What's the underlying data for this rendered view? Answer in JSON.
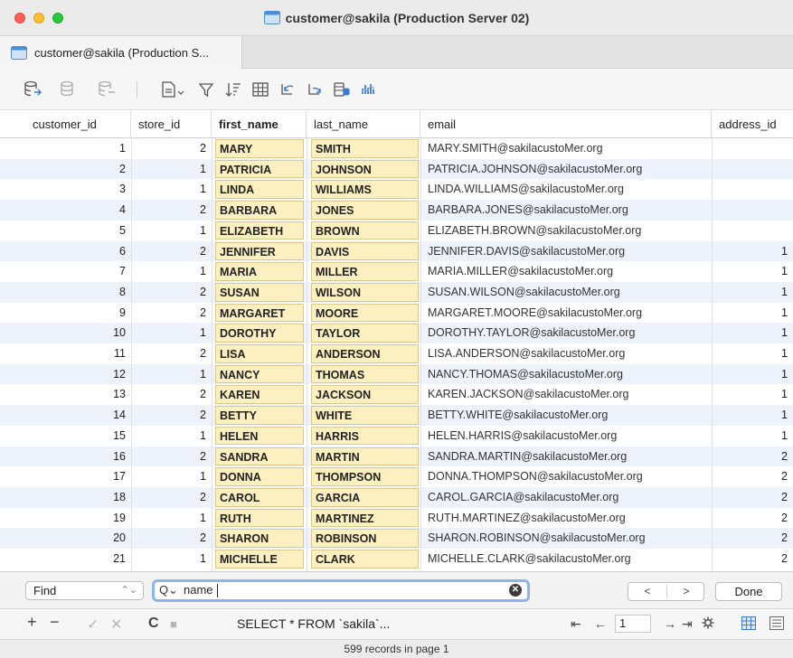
{
  "window": {
    "title": "customer@sakila (Production Server 02)"
  },
  "tabs": [
    {
      "label": "customer@sakila (Production S..."
    }
  ],
  "toolbar": {
    "icons": [
      "table-icon",
      "table-icon",
      "table-icon",
      "document-dropdown-icon",
      "filter-icon",
      "sort-icon",
      "grid-icon",
      "import-icon",
      "export-icon",
      "database-icon",
      "chart-icon"
    ]
  },
  "grid": {
    "columns": [
      "customer_id",
      "store_id",
      "first_name",
      "last_name",
      "email",
      "address_id"
    ],
    "rows": [
      {
        "id": "1",
        "store": "2",
        "first": "MARY",
        "last": "SMITH",
        "email": "MARY.SMITH@sakilacustoMer.org",
        "addr": ""
      },
      {
        "id": "2",
        "store": "1",
        "first": "PATRICIA",
        "last": "JOHNSON",
        "email": "PATRICIA.JOHNSON@sakilacustoMer.org",
        "addr": ""
      },
      {
        "id": "3",
        "store": "1",
        "first": "LINDA",
        "last": "WILLIAMS",
        "email": "LINDA.WILLIAMS@sakilacustoMer.org",
        "addr": ""
      },
      {
        "id": "4",
        "store": "2",
        "first": "BARBARA",
        "last": "JONES",
        "email": "BARBARA.JONES@sakilacustoMer.org",
        "addr": ""
      },
      {
        "id": "5",
        "store": "1",
        "first": "ELIZABETH",
        "last": "BROWN",
        "email": "ELIZABETH.BROWN@sakilacustoMer.org",
        "addr": ""
      },
      {
        "id": "6",
        "store": "2",
        "first": "JENNIFER",
        "last": "DAVIS",
        "email": "JENNIFER.DAVIS@sakilacustoMer.org",
        "addr": "1"
      },
      {
        "id": "7",
        "store": "1",
        "first": "MARIA",
        "last": "MILLER",
        "email": "MARIA.MILLER@sakilacustoMer.org",
        "addr": "1"
      },
      {
        "id": "8",
        "store": "2",
        "first": "SUSAN",
        "last": "WILSON",
        "email": "SUSAN.WILSON@sakilacustoMer.org",
        "addr": "1"
      },
      {
        "id": "9",
        "store": "2",
        "first": "MARGARET",
        "last": "MOORE",
        "email": "MARGARET.MOORE@sakilacustoMer.org",
        "addr": "1"
      },
      {
        "id": "10",
        "store": "1",
        "first": "DOROTHY",
        "last": "TAYLOR",
        "email": "DOROTHY.TAYLOR@sakilacustoMer.org",
        "addr": "1"
      },
      {
        "id": "11",
        "store": "2",
        "first": "LISA",
        "last": "ANDERSON",
        "email": "LISA.ANDERSON@sakilacustoMer.org",
        "addr": "1"
      },
      {
        "id": "12",
        "store": "1",
        "first": "NANCY",
        "last": "THOMAS",
        "email": "NANCY.THOMAS@sakilacustoMer.org",
        "addr": "1"
      },
      {
        "id": "13",
        "store": "2",
        "first": "KAREN",
        "last": "JACKSON",
        "email": "KAREN.JACKSON@sakilacustoMer.org",
        "addr": "1"
      },
      {
        "id": "14",
        "store": "2",
        "first": "BETTY",
        "last": "WHITE",
        "email": "BETTY.WHITE@sakilacustoMer.org",
        "addr": "1"
      },
      {
        "id": "15",
        "store": "1",
        "first": "HELEN",
        "last": "HARRIS",
        "email": "HELEN.HARRIS@sakilacustoMer.org",
        "addr": "1"
      },
      {
        "id": "16",
        "store": "2",
        "first": "SANDRA",
        "last": "MARTIN",
        "email": "SANDRA.MARTIN@sakilacustoMer.org",
        "addr": "2"
      },
      {
        "id": "17",
        "store": "1",
        "first": "DONNA",
        "last": "THOMPSON",
        "email": "DONNA.THOMPSON@sakilacustoMer.org",
        "addr": "2"
      },
      {
        "id": "18",
        "store": "2",
        "first": "CAROL",
        "last": "GARCIA",
        "email": "CAROL.GARCIA@sakilacustoMer.org",
        "addr": "2"
      },
      {
        "id": "19",
        "store": "1",
        "first": "RUTH",
        "last": "MARTINEZ",
        "email": "RUTH.MARTINEZ@sakilacustoMer.org",
        "addr": "2"
      },
      {
        "id": "20",
        "store": "2",
        "first": "SHARON",
        "last": "ROBINSON",
        "email": "SHARON.ROBINSON@sakilacustoMer.org",
        "addr": "2"
      },
      {
        "id": "21",
        "store": "1",
        "first": "MICHELLE",
        "last": "CLARK",
        "email": "MICHELLE.CLARK@sakilacustoMer.org",
        "addr": "2"
      }
    ]
  },
  "findbar": {
    "mode": "Find",
    "query": "name",
    "prev_label": "<",
    "next_label": ">",
    "done_label": "Done"
  },
  "bottombar": {
    "add": "+",
    "remove": "−",
    "apply": "✓",
    "discard": "✕",
    "refresh": "C",
    "stop": "■",
    "sql": "SELECT * FROM `sakila`...",
    "first_page": "⇤",
    "prev_page": "←",
    "page": "1",
    "next_page": "→",
    "last_page": "⇥"
  },
  "status": {
    "text": "599 records in page 1"
  },
  "colors": {
    "highlight": "#fcf0c0",
    "alt_row": "#eef3fb",
    "focus_ring": "#8db4f0"
  }
}
